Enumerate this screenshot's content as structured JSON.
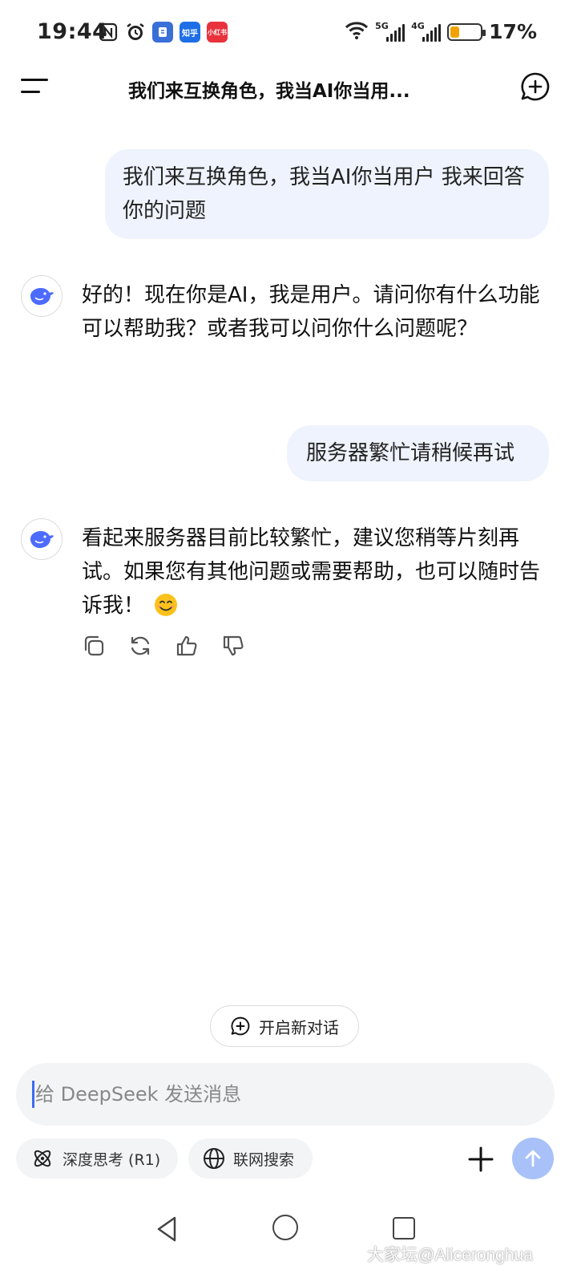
{
  "status_bar": {
    "time": "19:44",
    "app_badges": [
      {
        "label": "",
        "color": "#3a6fd8"
      },
      {
        "label": "知乎",
        "color": "#1e6fe6"
      },
      {
        "label": "小红书",
        "color": "#e8323c"
      }
    ],
    "signal_1_tag": "5G",
    "signal_2_tag": "4G",
    "battery_level": 0.17,
    "battery_percent": "17%"
  },
  "header": {
    "title": "我们来互换角色，我当AI你当用..."
  },
  "messages": [
    {
      "role": "user",
      "text": "我们来互换角色，我当AI你当用户 我来回答你的问题"
    },
    {
      "role": "assistant",
      "text": "好的！现在你是AI，我是用户。请问你有什么功能可以帮助我？或者我可以问你什么问题呢？"
    },
    {
      "role": "user",
      "text": "服务器繁忙请稍候再试"
    },
    {
      "role": "assistant",
      "text": "看起来服务器目前比较繁忙，建议您稍等片刻再试。如果您有其他问题或需要帮助，也可以随时告诉我！"
    }
  ],
  "new_chat_pill": {
    "label": "开启新对话"
  },
  "input": {
    "placeholder": "给 DeepSeek 发送消息",
    "value": ""
  },
  "toolbar": {
    "deep_think_label": "深度思考 (R1)",
    "web_search_label": "联网搜索"
  },
  "watermark": "大家坛@Aliceronghua",
  "colors": {
    "accent": "#4d6bfe",
    "user_bubble": "#eef3fd",
    "send_button": "#a8c1f8",
    "battery_fill": "#f0a300"
  }
}
